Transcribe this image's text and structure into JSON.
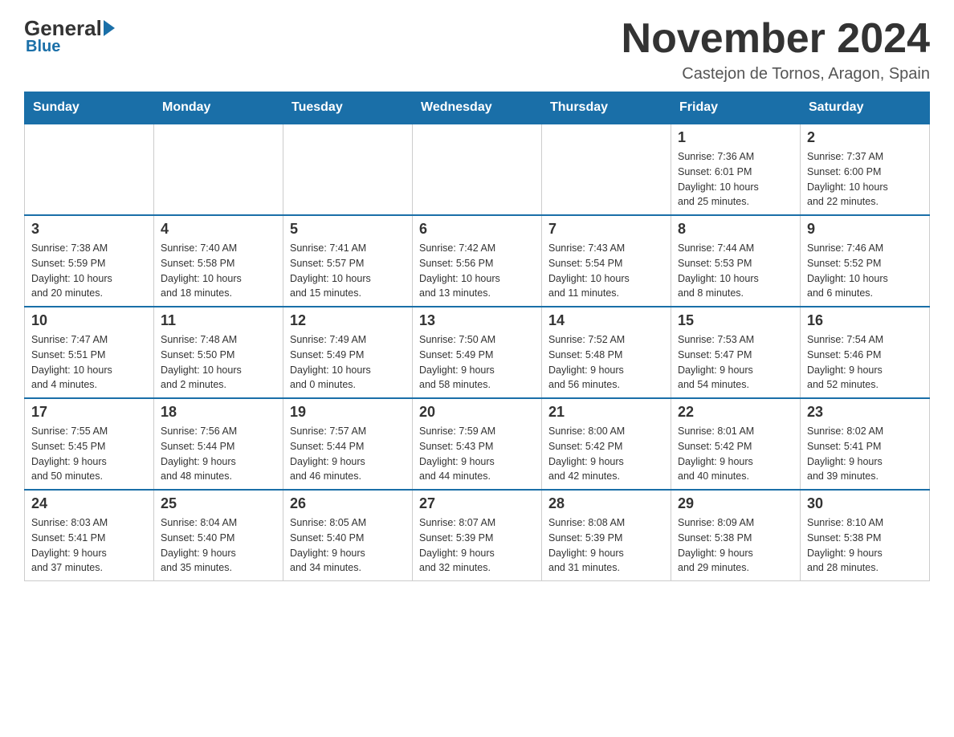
{
  "header": {
    "logo_general": "General",
    "logo_blue": "Blue",
    "main_title": "November 2024",
    "subtitle": "Castejon de Tornos, Aragon, Spain"
  },
  "calendar": {
    "headers": [
      "Sunday",
      "Monday",
      "Tuesday",
      "Wednesday",
      "Thursday",
      "Friday",
      "Saturday"
    ],
    "weeks": [
      [
        {
          "day": "",
          "info": ""
        },
        {
          "day": "",
          "info": ""
        },
        {
          "day": "",
          "info": ""
        },
        {
          "day": "",
          "info": ""
        },
        {
          "day": "",
          "info": ""
        },
        {
          "day": "1",
          "info": "Sunrise: 7:36 AM\nSunset: 6:01 PM\nDaylight: 10 hours\nand 25 minutes."
        },
        {
          "day": "2",
          "info": "Sunrise: 7:37 AM\nSunset: 6:00 PM\nDaylight: 10 hours\nand 22 minutes."
        }
      ],
      [
        {
          "day": "3",
          "info": "Sunrise: 7:38 AM\nSunset: 5:59 PM\nDaylight: 10 hours\nand 20 minutes."
        },
        {
          "day": "4",
          "info": "Sunrise: 7:40 AM\nSunset: 5:58 PM\nDaylight: 10 hours\nand 18 minutes."
        },
        {
          "day": "5",
          "info": "Sunrise: 7:41 AM\nSunset: 5:57 PM\nDaylight: 10 hours\nand 15 minutes."
        },
        {
          "day": "6",
          "info": "Sunrise: 7:42 AM\nSunset: 5:56 PM\nDaylight: 10 hours\nand 13 minutes."
        },
        {
          "day": "7",
          "info": "Sunrise: 7:43 AM\nSunset: 5:54 PM\nDaylight: 10 hours\nand 11 minutes."
        },
        {
          "day": "8",
          "info": "Sunrise: 7:44 AM\nSunset: 5:53 PM\nDaylight: 10 hours\nand 8 minutes."
        },
        {
          "day": "9",
          "info": "Sunrise: 7:46 AM\nSunset: 5:52 PM\nDaylight: 10 hours\nand 6 minutes."
        }
      ],
      [
        {
          "day": "10",
          "info": "Sunrise: 7:47 AM\nSunset: 5:51 PM\nDaylight: 10 hours\nand 4 minutes."
        },
        {
          "day": "11",
          "info": "Sunrise: 7:48 AM\nSunset: 5:50 PM\nDaylight: 10 hours\nand 2 minutes."
        },
        {
          "day": "12",
          "info": "Sunrise: 7:49 AM\nSunset: 5:49 PM\nDaylight: 10 hours\nand 0 minutes."
        },
        {
          "day": "13",
          "info": "Sunrise: 7:50 AM\nSunset: 5:49 PM\nDaylight: 9 hours\nand 58 minutes."
        },
        {
          "day": "14",
          "info": "Sunrise: 7:52 AM\nSunset: 5:48 PM\nDaylight: 9 hours\nand 56 minutes."
        },
        {
          "day": "15",
          "info": "Sunrise: 7:53 AM\nSunset: 5:47 PM\nDaylight: 9 hours\nand 54 minutes."
        },
        {
          "day": "16",
          "info": "Sunrise: 7:54 AM\nSunset: 5:46 PM\nDaylight: 9 hours\nand 52 minutes."
        }
      ],
      [
        {
          "day": "17",
          "info": "Sunrise: 7:55 AM\nSunset: 5:45 PM\nDaylight: 9 hours\nand 50 minutes."
        },
        {
          "day": "18",
          "info": "Sunrise: 7:56 AM\nSunset: 5:44 PM\nDaylight: 9 hours\nand 48 minutes."
        },
        {
          "day": "19",
          "info": "Sunrise: 7:57 AM\nSunset: 5:44 PM\nDaylight: 9 hours\nand 46 minutes."
        },
        {
          "day": "20",
          "info": "Sunrise: 7:59 AM\nSunset: 5:43 PM\nDaylight: 9 hours\nand 44 minutes."
        },
        {
          "day": "21",
          "info": "Sunrise: 8:00 AM\nSunset: 5:42 PM\nDaylight: 9 hours\nand 42 minutes."
        },
        {
          "day": "22",
          "info": "Sunrise: 8:01 AM\nSunset: 5:42 PM\nDaylight: 9 hours\nand 40 minutes."
        },
        {
          "day": "23",
          "info": "Sunrise: 8:02 AM\nSunset: 5:41 PM\nDaylight: 9 hours\nand 39 minutes."
        }
      ],
      [
        {
          "day": "24",
          "info": "Sunrise: 8:03 AM\nSunset: 5:41 PM\nDaylight: 9 hours\nand 37 minutes."
        },
        {
          "day": "25",
          "info": "Sunrise: 8:04 AM\nSunset: 5:40 PM\nDaylight: 9 hours\nand 35 minutes."
        },
        {
          "day": "26",
          "info": "Sunrise: 8:05 AM\nSunset: 5:40 PM\nDaylight: 9 hours\nand 34 minutes."
        },
        {
          "day": "27",
          "info": "Sunrise: 8:07 AM\nSunset: 5:39 PM\nDaylight: 9 hours\nand 32 minutes."
        },
        {
          "day": "28",
          "info": "Sunrise: 8:08 AM\nSunset: 5:39 PM\nDaylight: 9 hours\nand 31 minutes."
        },
        {
          "day": "29",
          "info": "Sunrise: 8:09 AM\nSunset: 5:38 PM\nDaylight: 9 hours\nand 29 minutes."
        },
        {
          "day": "30",
          "info": "Sunrise: 8:10 AM\nSunset: 5:38 PM\nDaylight: 9 hours\nand 28 minutes."
        }
      ]
    ]
  }
}
